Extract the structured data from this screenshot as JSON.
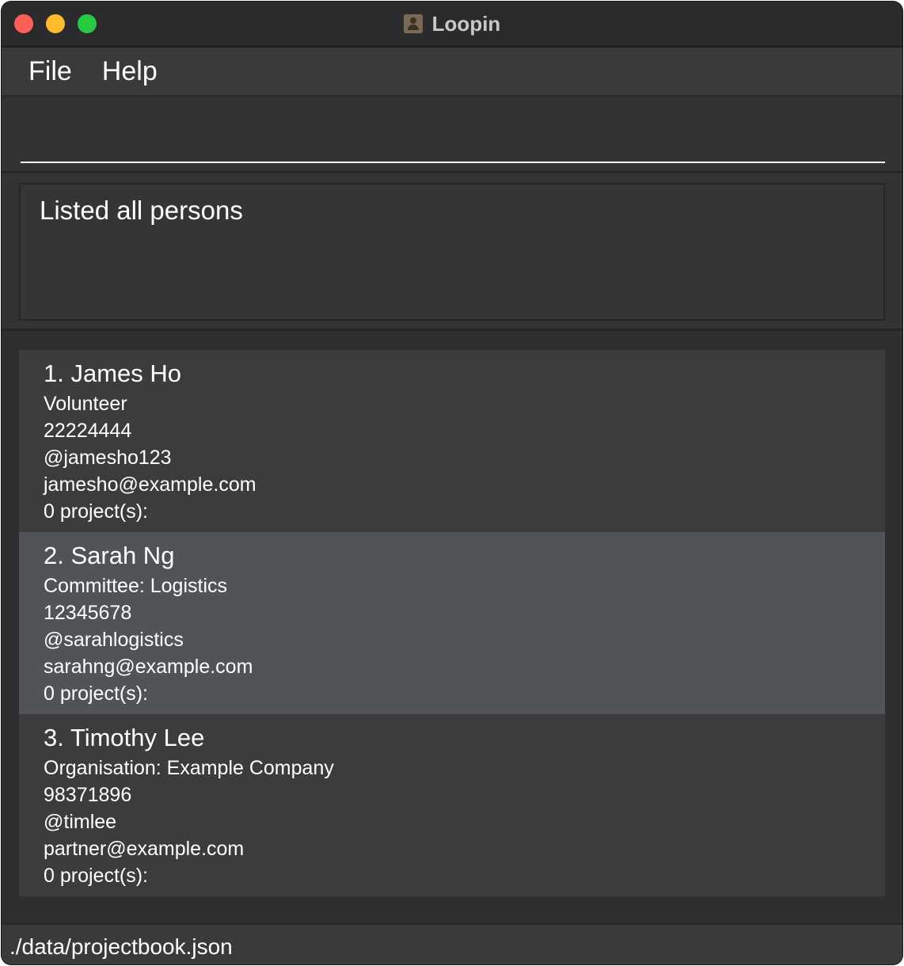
{
  "window": {
    "title": "Loopin"
  },
  "menu": {
    "items": [
      {
        "label": "File"
      },
      {
        "label": "Help"
      }
    ]
  },
  "command": {
    "value": "",
    "placeholder": ""
  },
  "result": {
    "message": "Listed all persons"
  },
  "persons": [
    {
      "name": "1. James Ho",
      "role": "Volunteer",
      "phone": "22224444",
      "handle": "@jamesho123",
      "email": "jamesho@example.com",
      "projects": "0 project(s):",
      "selected": false
    },
    {
      "name": "2. Sarah Ng",
      "role": "Committee: Logistics",
      "phone": "12345678",
      "handle": "@sarahlogistics",
      "email": "sarahng@example.com",
      "projects": "0 project(s):",
      "selected": true
    },
    {
      "name": "3. Timothy Lee",
      "role": "Organisation: Example Company",
      "phone": "98371896",
      "handle": "@timlee",
      "email": "partner@example.com",
      "projects": "0 project(s):",
      "selected": false
    }
  ],
  "status": {
    "path": "./data/projectbook.json"
  },
  "colors": {
    "background": "#2f2f31",
    "card": "#3c3c3e",
    "card_selected": "#505457",
    "close": "#fe5f57",
    "minimize": "#febb2e",
    "zoom": "#28c840"
  }
}
